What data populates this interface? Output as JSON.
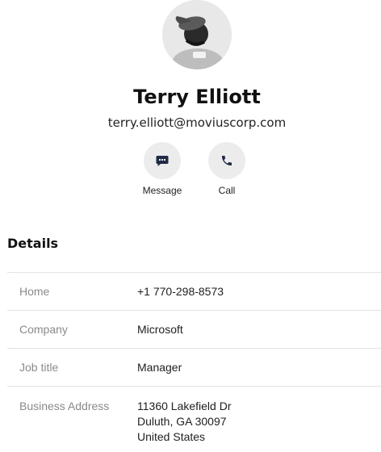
{
  "contact": {
    "name": "Terry Elliott",
    "email": "terry.elliott@moviuscorp.com"
  },
  "actions": [
    {
      "label": "Message",
      "icon": "message-icon"
    },
    {
      "label": "Call",
      "icon": "phone-icon"
    }
  ],
  "details": {
    "title": "Details",
    "rows": [
      {
        "label": "Home",
        "value": "+1 770-298-8573"
      },
      {
        "label": "Company",
        "value": "Microsoft"
      },
      {
        "label": "Job title",
        "value": "Manager"
      }
    ],
    "address": {
      "label": "Business Address",
      "lines": [
        "11360 Lakefield Dr",
        "Duluth, GA 30097",
        "United States"
      ]
    }
  },
  "colors": {
    "icon_fill": "#1f2a44",
    "circle_bg": "#ececec",
    "divider": "#e3e3e3",
    "label_gray": "#8a8a8a"
  }
}
